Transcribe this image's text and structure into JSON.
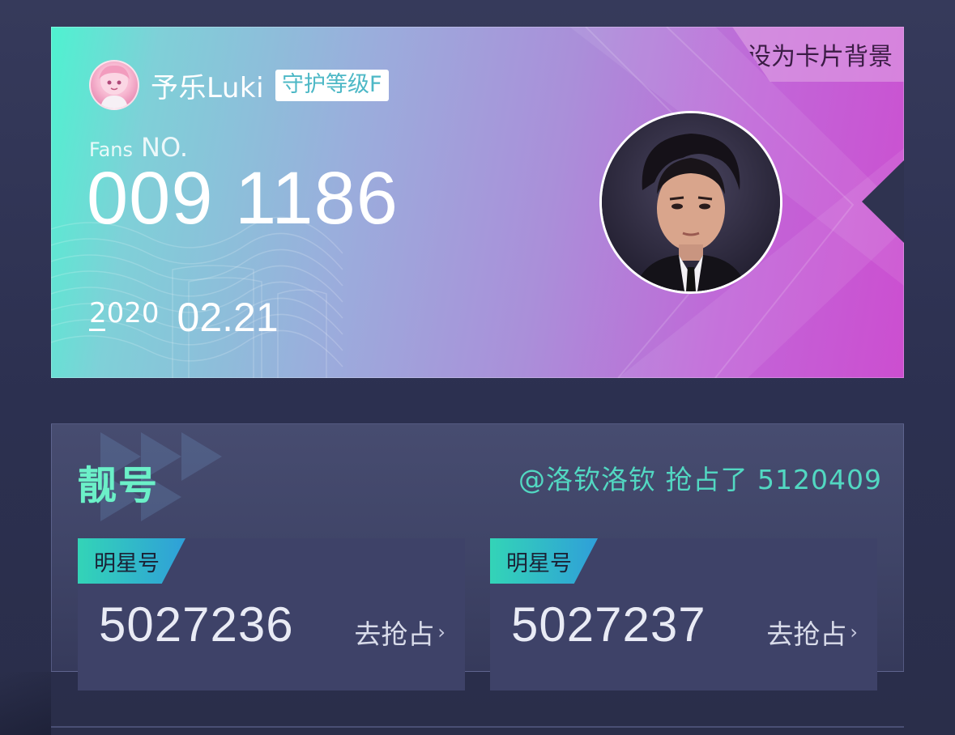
{
  "card": {
    "set_background_label": "设为卡片背景",
    "username": "予乐Luki",
    "guard_level": "守护等级F",
    "fans_label_small": "Fans",
    "fans_label_big": "NO.",
    "fans_number": "009 1186",
    "date_year": "2020",
    "date_month_day": "02.21"
  },
  "nice_numbers": {
    "title": "靓号",
    "grab_info": "@洛钦洛钦  抢占了 5120409",
    "items": [
      {
        "tag": "明星号",
        "number": "5027236",
        "action": "去抢占"
      },
      {
        "tag": "明星号",
        "number": "5027237",
        "action": "去抢占"
      }
    ]
  },
  "icons": {
    "chevron": "chevron-right-icon",
    "user_avatar": "anime-avatar",
    "star_avatar": "star-portrait"
  },
  "colors": {
    "card_gradient_start": "#4ef2d0",
    "card_gradient_end": "#cc4ed0",
    "title_accent": "#6cf0c8",
    "grab_info": "#52d8c2",
    "tag_gradient_start": "#33d4b7",
    "tag_gradient_end": "#2f9fd9"
  }
}
